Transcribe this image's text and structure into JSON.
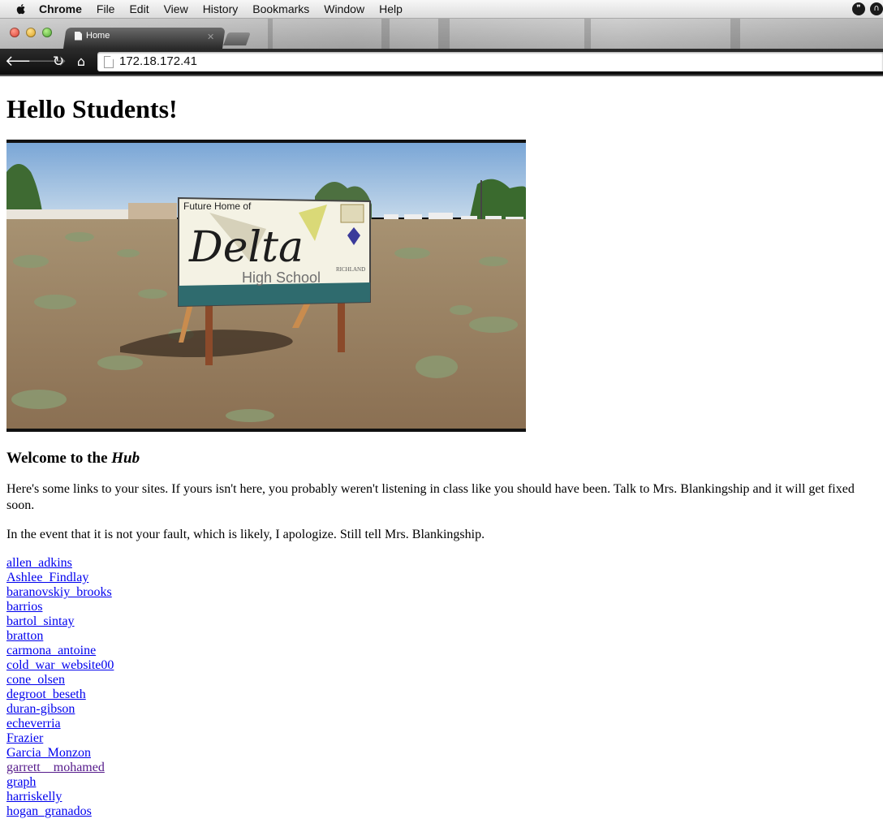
{
  "menubar": {
    "app_name": "Chrome",
    "items": [
      "File",
      "Edit",
      "View",
      "History",
      "Bookmarks",
      "Window",
      "Help"
    ]
  },
  "tab": {
    "title": "Home"
  },
  "toolbar": {
    "url": "172.18.172.41"
  },
  "page": {
    "heading": "Hello Students!",
    "image": {
      "sign_line1": "Future Home of",
      "sign_logo": "Delta",
      "sign_line2": "High School",
      "sign_side_text": "RICHLAND"
    },
    "welcome_prefix": "Welcome to the ",
    "welcome_emphasis": "Hub",
    "paragraph1": "Here's some links to your sites. If yours isn't here, you probably weren't listening in class like you should have been. Talk to Mrs. Blankingship and it will get fixed soon.",
    "paragraph2": "In the event that it is not your fault, which is likely, I apologize. Still tell Mrs. Blankingship.",
    "links": [
      "allen_adkins",
      "Ashlee_Findlay",
      "baranovskiy_brooks",
      "barrios",
      "bartol_sintay",
      "bratton",
      "carmona_antoine",
      "cold_war_website00",
      "cone_olsen",
      "degroot_beseth",
      "duran-gibson",
      "echeverria",
      "Frazier",
      "Garcia_Monzon",
      "garrett__mohamed",
      "graph",
      "harriskelly",
      "hogan_granados"
    ]
  },
  "colors": {
    "link": "#0000ee",
    "visited_link": "#551a8b"
  }
}
